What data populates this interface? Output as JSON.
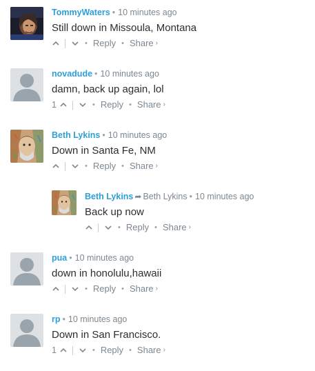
{
  "comments": [
    {
      "author": "TommyWaters",
      "time": "10 minutes ago",
      "text": "Still down in Missoula, Montana",
      "votes": "",
      "avatar": "photo-avatar-tommy"
    },
    {
      "author": "novadude",
      "time": "10 minutes ago",
      "text": "damn, back up again, lol",
      "votes": "1",
      "avatar": "default-avatar"
    },
    {
      "author": "Beth Lykins",
      "time": "10 minutes ago",
      "text": "Down in Santa Fe, NM",
      "votes": "",
      "avatar": "painted-avatar-beth"
    },
    {
      "author": "Beth Lykins",
      "reply_to": "Beth Lykins",
      "time": "10 minutes ago",
      "text": "Back up now",
      "votes": "",
      "avatar": "painted-avatar-beth"
    },
    {
      "author": "pua",
      "time": "10 minutes ago",
      "text": "down in honolulu,hawaii",
      "votes": "",
      "avatar": "default-avatar"
    },
    {
      "author": "rp",
      "time": "10 minutes ago",
      "text": "Down in San Francisco.",
      "votes": "1",
      "avatar": "default-avatar"
    }
  ],
  "labels": {
    "reply": "Reply",
    "share": "Share",
    "share_caret": "›",
    "reply_arrow": "➦"
  },
  "colors": {
    "author_link": "#2e9fd8",
    "meta_gray": "#7d8791",
    "body_text": "#2a2e2e",
    "default_avatar_bg": "#dde1e4",
    "default_avatar_fg": "#9aa4ac"
  }
}
